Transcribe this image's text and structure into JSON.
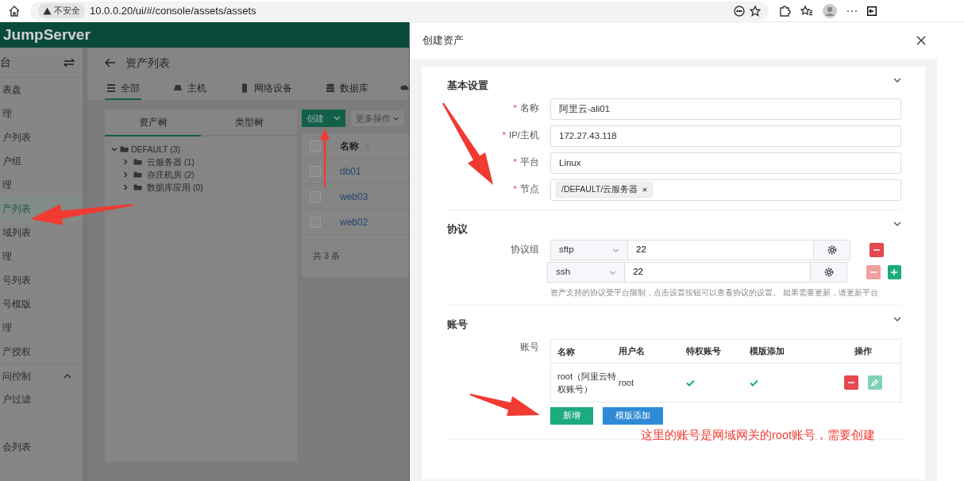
{
  "browser": {
    "security_label": "不安全",
    "url": "10.0.0.20/ui/#/console/assets/assets"
  },
  "app": {
    "logo": "JumpServer"
  },
  "sidebar": {
    "title": "台",
    "items": [
      {
        "label": "表盘",
        "kind": "item",
        "selected": false
      },
      {
        "label": "理",
        "kind": "group",
        "selected": false
      },
      {
        "label": "户列表",
        "kind": "item",
        "selected": false
      },
      {
        "label": "户组",
        "kind": "item",
        "selected": false
      },
      {
        "label": "理",
        "kind": "group",
        "selected": false
      },
      {
        "label": "产列表",
        "kind": "item",
        "selected": true
      },
      {
        "label": "域列表",
        "kind": "item",
        "selected": false
      },
      {
        "label": "理",
        "kind": "group",
        "selected": false
      },
      {
        "label": "号列表",
        "kind": "item",
        "selected": false
      },
      {
        "label": "号模版",
        "kind": "item",
        "selected": false
      },
      {
        "label": "理",
        "kind": "group",
        "selected": false
      },
      {
        "label": "产授权",
        "kind": "item",
        "selected": false
      },
      {
        "label": "问控制",
        "kind": "section",
        "selected": false,
        "expanded": true
      },
      {
        "label": "户过滤",
        "kind": "item",
        "selected": false
      },
      {
        "label": "会列表",
        "kind": "item",
        "selected": false
      }
    ]
  },
  "main": {
    "title": "资产列表",
    "tabs": [
      {
        "label": "全部",
        "selected": true
      },
      {
        "label": "主机",
        "selected": false
      },
      {
        "label": "网络设备",
        "selected": false
      },
      {
        "label": "数据库",
        "selected": false
      }
    ],
    "tree_tabs": [
      {
        "label": "资产树",
        "selected": true
      },
      {
        "label": "类型树",
        "selected": false
      }
    ],
    "tree": {
      "label": "DEFAULT (3)",
      "expanded": true,
      "children": [
        {
          "label": "云服务器 (1)",
          "expanded": false
        },
        {
          "label": "亦庄机房 (2)",
          "expanded": false
        },
        {
          "label": "数据库应用 (0)",
          "expanded": false
        }
      ]
    },
    "create_button": "创建",
    "more_button": "更多操作",
    "table": {
      "columns": [
        "名称"
      ],
      "select_all_checked": false,
      "rows": [
        {
          "name": "db01",
          "checked": false
        },
        {
          "name": "web03",
          "checked": false
        },
        {
          "name": "web02",
          "checked": false
        }
      ]
    },
    "total": "共 3 条"
  },
  "drawer": {
    "title": "创建资产",
    "basic": {
      "title": "基本设置",
      "expanded": true,
      "required_mark": "*",
      "fields": [
        {
          "label": "名称",
          "required": true,
          "kind": "text",
          "value": "阿里云-ali01"
        },
        {
          "label": "IP/主机",
          "required": true,
          "kind": "text",
          "value": "172.27.43.118"
        },
        {
          "label": "平台",
          "required": true,
          "kind": "text",
          "value": "Linux"
        },
        {
          "label": "节点",
          "required": true,
          "kind": "tags",
          "tags": [
            "/DEFAULT/云服务器"
          ]
        }
      ]
    },
    "protocols": {
      "title": "协议",
      "expanded": true,
      "label": "协议组",
      "rows": [
        {
          "name": "sftp",
          "port": "22",
          "remove_disabled": false,
          "can_add": false
        },
        {
          "name": "ssh",
          "port": "22",
          "remove_disabled": true,
          "can_add": true
        }
      ],
      "hint": "资产支持的协议受平台限制，点击设置按钮可以查看协议的设置。 如果需要更新，请更新平台"
    },
    "accounts": {
      "title": "账号",
      "expanded": true,
      "label": "账号",
      "columns": [
        "名称",
        "用户名",
        "特权账号",
        "模版添加",
        "操作"
      ],
      "rows": [
        {
          "name": "root（阿里云特权账号）",
          "username": "root",
          "privileged": true,
          "template": true
        }
      ],
      "buttons": [
        {
          "label": "新增",
          "kind": "add"
        },
        {
          "label": "模版添加",
          "kind": "template"
        }
      ]
    }
  },
  "annotation": "这里的账号是网域网关的root账号，需要创建"
}
